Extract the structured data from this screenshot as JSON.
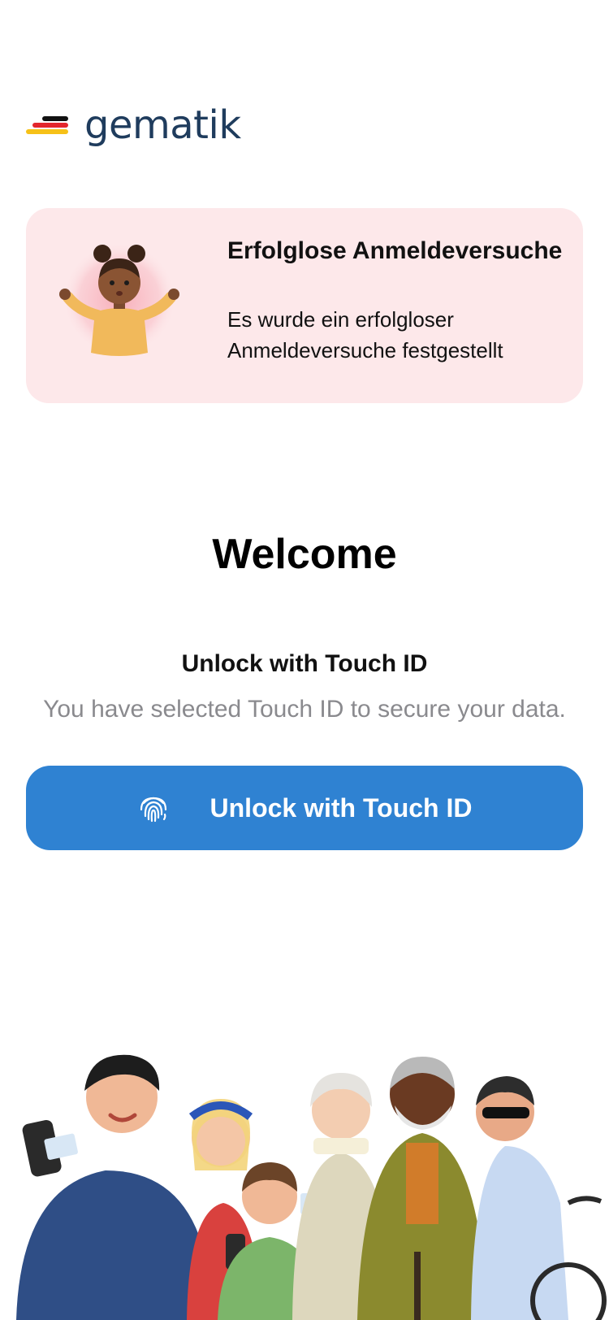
{
  "logo": {
    "text": "gematik",
    "flag_colors": [
      "#111111",
      "#e3262d",
      "#f6c118"
    ]
  },
  "alert": {
    "title": "Erfolglose Anmeldeversuche",
    "message": "Es wurde ein erfolgloser Anmeldeversuche festgestellt",
    "background_color": "#fde8ea",
    "illustration": "shrugging-girl-illustration"
  },
  "welcome": {
    "title": "Welcome"
  },
  "unlock": {
    "title": "Unlock with Touch ID",
    "description": "You have selected Touch ID to secure your data.",
    "button_label": "Unlock with Touch ID",
    "button_icon": "fingerprint-icon",
    "button_color": "#2f82d2"
  },
  "footer": {
    "illustration": "people-group-illustration"
  }
}
